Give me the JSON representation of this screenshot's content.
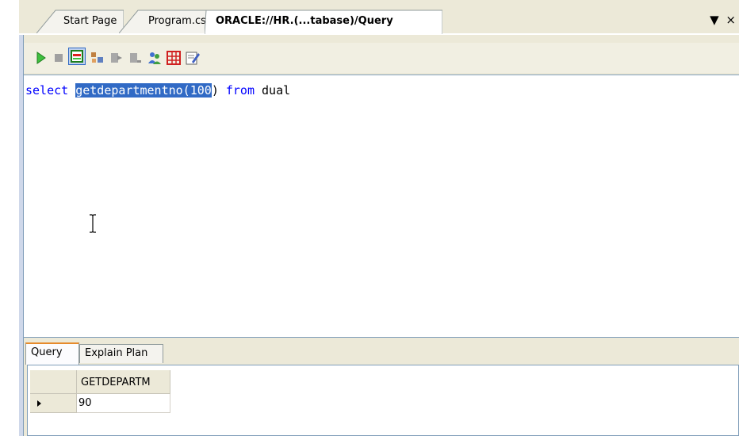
{
  "tabs": [
    {
      "label": "Start Page"
    },
    {
      "label": "Program.cs"
    },
    {
      "label": "ORACLE://HR.(...tabase)/Query",
      "active": true
    }
  ],
  "tab_controls": "▼ ×",
  "toolbar": {
    "buttons": [
      {
        "icon": "execute-icon"
      },
      {
        "icon": "stop-icon"
      },
      {
        "icon": "results-icon",
        "pressed": true
      },
      {
        "icon": "tree-icon"
      },
      {
        "icon": "step-icon"
      },
      {
        "icon": "step-over-icon"
      },
      {
        "icon": "users-icon"
      },
      {
        "icon": "grid-icon"
      },
      {
        "icon": "edit-icon"
      }
    ]
  },
  "editor": {
    "keyword_select": "select",
    "space1": " ",
    "selected_text": "getdepartmentno(100",
    "after_selection": ")",
    "space2": " ",
    "keyword_from": "from",
    "space3": " ",
    "table_name": "dual"
  },
  "result_tabs": [
    {
      "label": "Query",
      "active": true
    },
    {
      "label": "Explain Plan"
    }
  ],
  "grid": {
    "columns": [
      "GETDEPARTM"
    ],
    "rows": [
      [
        "90"
      ]
    ]
  },
  "colors": {
    "keyword": "#0000ff",
    "selection": "#316ac5",
    "chrome": "#ece9d8"
  }
}
